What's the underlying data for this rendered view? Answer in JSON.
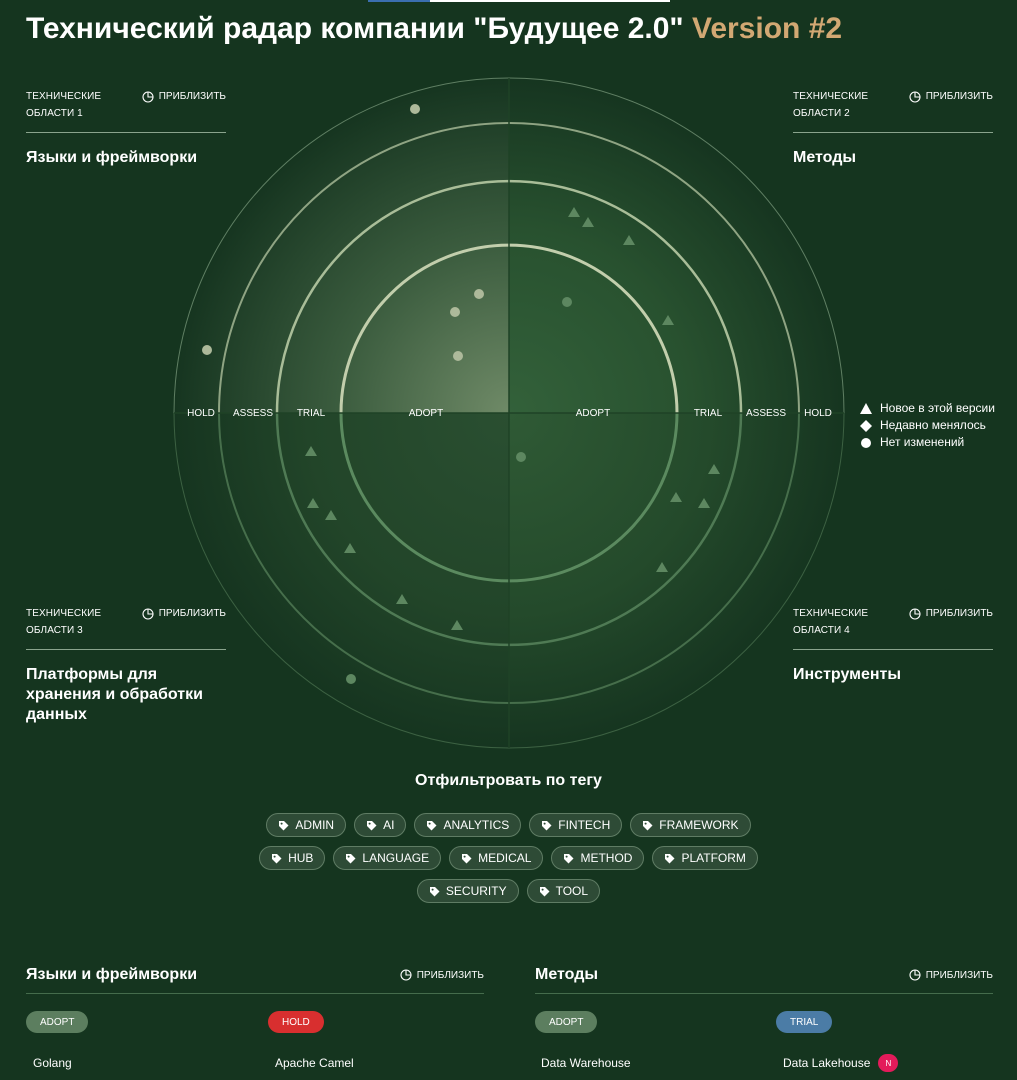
{
  "header": {
    "title": "Технический радар компании \"Будущее 2.0\"",
    "version": "Version #2"
  },
  "zoom_label": "ПРИБЛИЗИТЬ",
  "quadrants": [
    {
      "label_line1": "ТЕХНИЧЕСКИЕ",
      "label_line2": "ОБЛАСТИ 1",
      "name": "Языки и фреймворки"
    },
    {
      "label_line1": "ТЕХНИЧЕСКИЕ",
      "label_line2": "ОБЛАСТИ 2",
      "name": "Методы"
    },
    {
      "label_line1": "ТЕХНИЧЕСКИЕ",
      "label_line2": "ОБЛАСТИ 3",
      "name": "Платформы для хранения и обработки данных"
    },
    {
      "label_line1": "ТЕХНИЧЕСКИЕ",
      "label_line2": "ОБЛАСТИ 4",
      "name": "Инструменты"
    }
  ],
  "rings": [
    "ADOPT",
    "TRIAL",
    "ASSESS",
    "HOLD"
  ],
  "legend": [
    {
      "symbol": "triangle",
      "text": "Новое в этой версии"
    },
    {
      "symbol": "diamond",
      "text": "Недавно менялось"
    },
    {
      "symbol": "circle",
      "text": "Нет изменений"
    }
  ],
  "filter": {
    "title": "Отфильтровать по тегу",
    "rows": [
      [
        "ADMIN",
        "AI",
        "ANALYTICS",
        "FINTECH",
        "FRAMEWORK"
      ],
      [
        "HUB",
        "LANGUAGE",
        "MEDICAL",
        "METHOD",
        "PLATFORM"
      ],
      [
        "SECURITY",
        "TOOL"
      ]
    ]
  },
  "sections": [
    {
      "title": "Языки и фреймворки",
      "zoom": "ПРИБЛИЗИТЬ",
      "col1_ring": "ADOPT",
      "col1_items": [
        "Golang"
      ],
      "col2_ring": "HOLD",
      "col2_items": [
        "Apache Camel"
      ]
    },
    {
      "title": "Методы",
      "zoom": "ПРИБЛИЗИТЬ",
      "col1_ring": "ADOPT",
      "col1_items": [
        "Data Warehouse"
      ],
      "col2_ring": "TRIAL",
      "col2_items": [
        "Data Lakehouse"
      ],
      "col2_badge": "N"
    }
  ],
  "colors": {
    "background": "#15351f",
    "accent": "#d2a873",
    "blip": "#adb99a",
    "blip_lower": "#5d8760",
    "adopt": "#5c7e5f",
    "hold": "#d82f2f",
    "trial": "#4b7ca6",
    "new_badge": "#e31b5a"
  },
  "icons": {
    "zoom": "pie-chart-icon",
    "tag": "tag-icon"
  }
}
